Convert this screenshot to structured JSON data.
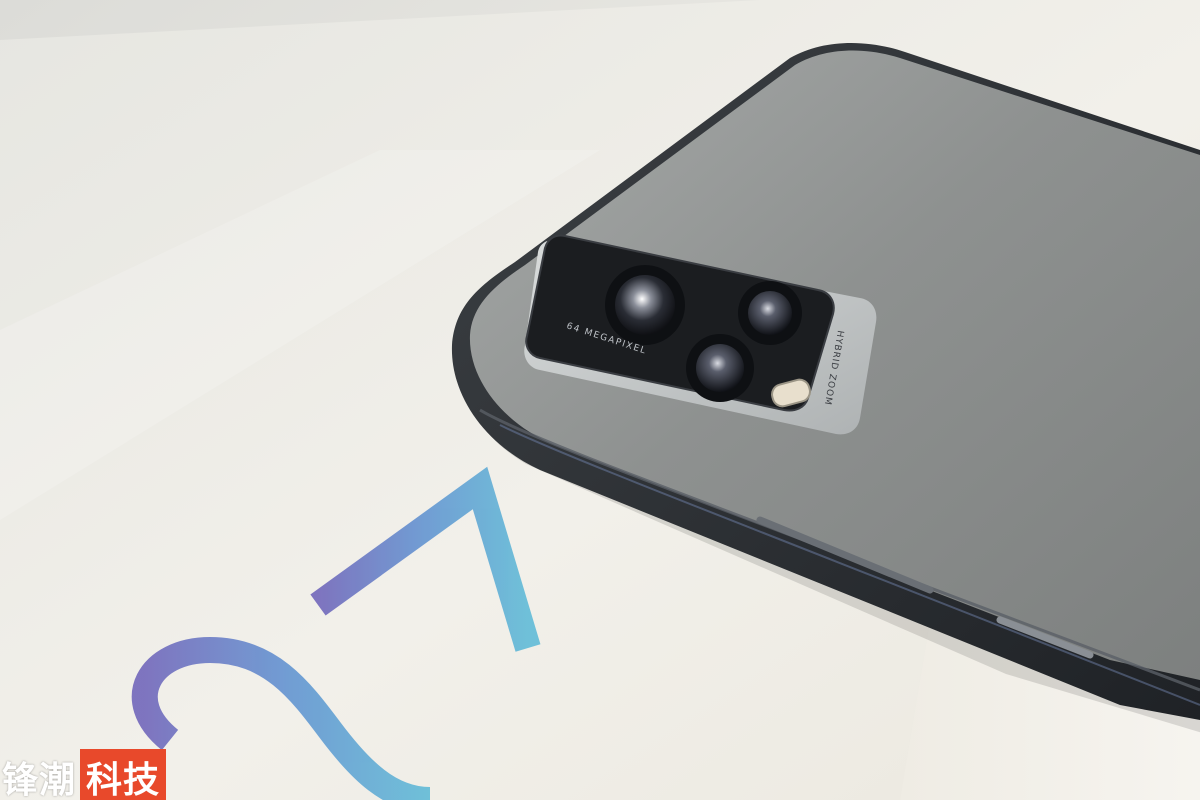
{
  "photo": {
    "box_text": "S7",
    "camera_text": "64 MEGAPIXEL",
    "flash_text": "HYBRID ZOOM"
  },
  "watermark": {
    "part1": "锋潮",
    "part2": "科技"
  },
  "colors": {
    "box": "#efede6",
    "phone_body": "#8e9190",
    "phone_edge": "#2b2e31",
    "camera_module": "#1b1d20",
    "watermark_accent": "#e8492b"
  }
}
